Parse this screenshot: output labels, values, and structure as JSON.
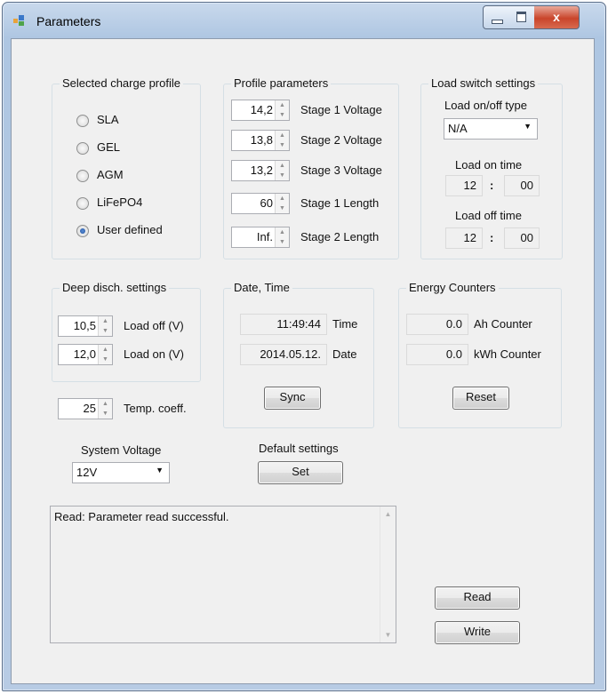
{
  "window": {
    "title": "Parameters",
    "close_glyph": "x"
  },
  "charge_profile": {
    "title": "Selected charge profile",
    "options": [
      {
        "label": "SLA",
        "selected": false
      },
      {
        "label": "GEL",
        "selected": false
      },
      {
        "label": "AGM",
        "selected": false
      },
      {
        "label": "LiFePO4",
        "selected": false
      },
      {
        "label": "User defined",
        "selected": true
      }
    ]
  },
  "profile_params": {
    "title": "Profile parameters",
    "rows": [
      {
        "value": "14,2",
        "label": "Stage 1 Voltage"
      },
      {
        "value": "13,8",
        "label": "Stage 2 Voltage"
      },
      {
        "value": "13,2",
        "label": "Stage 3 Voltage"
      },
      {
        "value": "60",
        "label": "Stage 1 Length"
      },
      {
        "value": "Inf.",
        "label": "Stage 2 Length"
      }
    ]
  },
  "load_switch": {
    "title": "Load switch settings",
    "type_label": "Load on/off type",
    "type_value": "N/A",
    "on_label": "Load on time",
    "on_hour": "12",
    "on_min": "00",
    "off_label": "Load off time",
    "off_hour": "12",
    "off_min": "00",
    "colon": ":"
  },
  "deep_disch": {
    "title": "Deep disch. settings",
    "rows": [
      {
        "value": "10,5",
        "label": "Load off (V)"
      },
      {
        "value": "12,0",
        "label": "Load on (V)"
      }
    ]
  },
  "temp": {
    "value": "25",
    "label": "Temp. coeff."
  },
  "datetime": {
    "title": "Date, Time",
    "time_value": "11:49:44",
    "time_label": "Time",
    "date_value": "2014.05.12.",
    "date_label": "Date",
    "sync_label": "Sync"
  },
  "energy": {
    "title": "Energy Counters",
    "ah_value": "0.0",
    "ah_label": "Ah Counter",
    "kwh_value": "0.0",
    "kwh_label": "kWh Counter",
    "reset_label": "Reset"
  },
  "system_voltage": {
    "label": "System Voltage",
    "value": "12V"
  },
  "defaults": {
    "label": "Default settings",
    "set_label": "Set"
  },
  "log": {
    "text": "Read: Parameter read successful."
  },
  "actions": {
    "read_label": "Read",
    "write_label": "Write"
  },
  "colors": {
    "titlebar": "#aec6e2",
    "client": "#f0f0f0",
    "close": "#c9452b",
    "radio_on": "#1f4f9e"
  }
}
